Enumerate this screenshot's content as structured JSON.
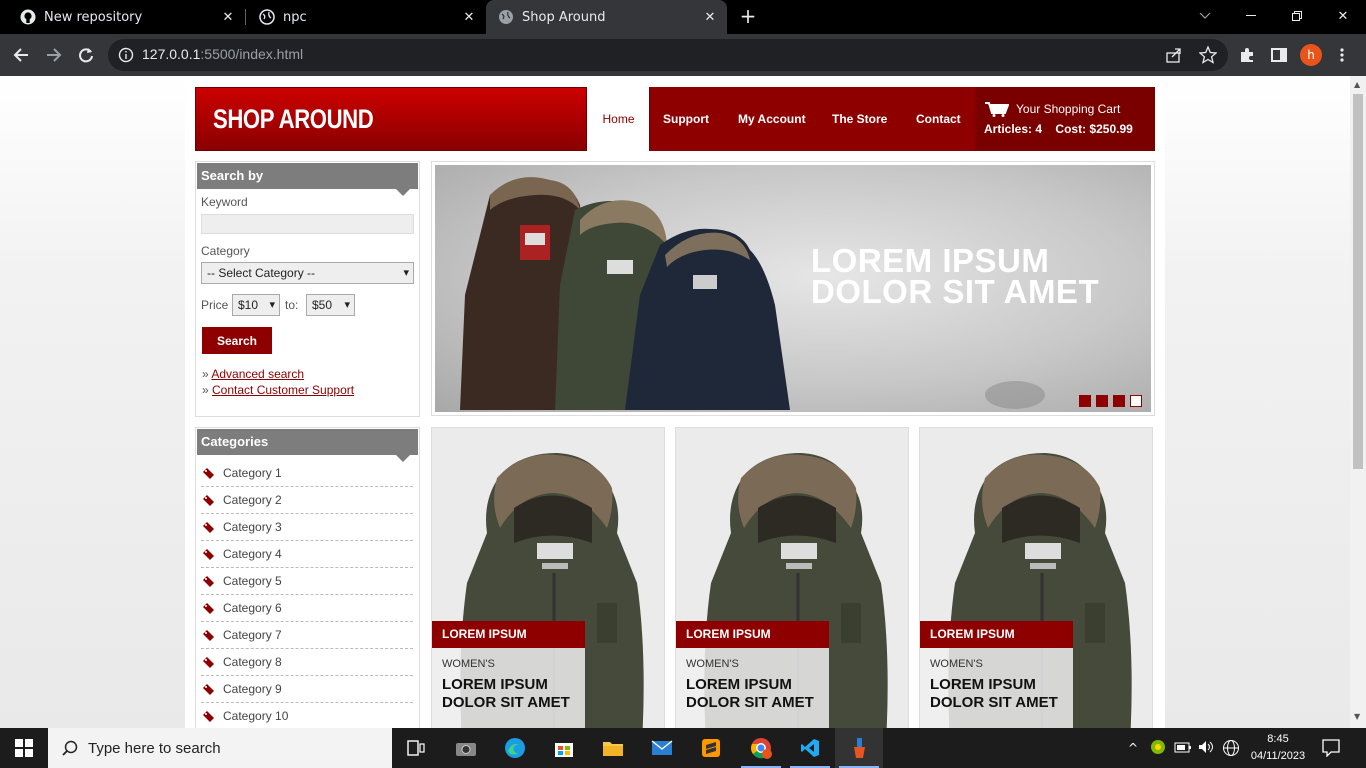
{
  "browser": {
    "tabs": [
      {
        "title": "New repository",
        "icon": "github-icon"
      },
      {
        "title": "npc",
        "icon": "globe-icon"
      },
      {
        "title": "Shop Around",
        "icon": "globe-icon",
        "active": true
      }
    ],
    "url_host": "127.0.0.1",
    "url_rest": ":5500/index.html",
    "profile_initial": "h"
  },
  "site": {
    "logo": "SHOP AROUND",
    "nav": [
      "Home",
      "Support",
      "My Account",
      "The Store",
      "Contact"
    ],
    "cart": {
      "title": "Your Shopping Cart",
      "articles_label": "Articles:",
      "articles": "4",
      "cost_label": "Cost:",
      "cost": "$250.99"
    },
    "search": {
      "heading": "Search by",
      "keyword_label": "Keyword",
      "category_label": "Category",
      "category_value": "-- Select Category --",
      "price_label": "Price",
      "price_from": "$10",
      "to_label": "to:",
      "price_to": "$50",
      "button": "Search",
      "links": [
        "Advanced search",
        "Contact Customer Support"
      ]
    },
    "categories": {
      "heading": "Categories",
      "items": [
        "Category 1",
        "Category 2",
        "Category 3",
        "Category 4",
        "Category 5",
        "Category 6",
        "Category 7",
        "Category 8",
        "Category 9",
        "Category 10"
      ]
    },
    "slider": {
      "text": "LOREM IPSUM DOLOR SIT AMET",
      "slides": 4,
      "active_slide": 4
    },
    "products": [
      {
        "tag": "LOREM IPSUM",
        "category": "WOMEN'S",
        "name": "LOREM IPSUM DOLOR SIT AMET"
      },
      {
        "tag": "LOREM IPSUM",
        "category": "WOMEN'S",
        "name": "LOREM IPSUM DOLOR SIT AMET"
      },
      {
        "tag": "LOREM IPSUM",
        "category": "WOMEN'S",
        "name": "LOREM IPSUM DOLOR SIT AMET"
      }
    ]
  },
  "taskbar": {
    "search_placeholder": "Type here to search",
    "time": "8:45",
    "date": "04/11/2023"
  },
  "colors": {
    "brand": "#8e0000",
    "chrome_dark": "#35363a"
  }
}
